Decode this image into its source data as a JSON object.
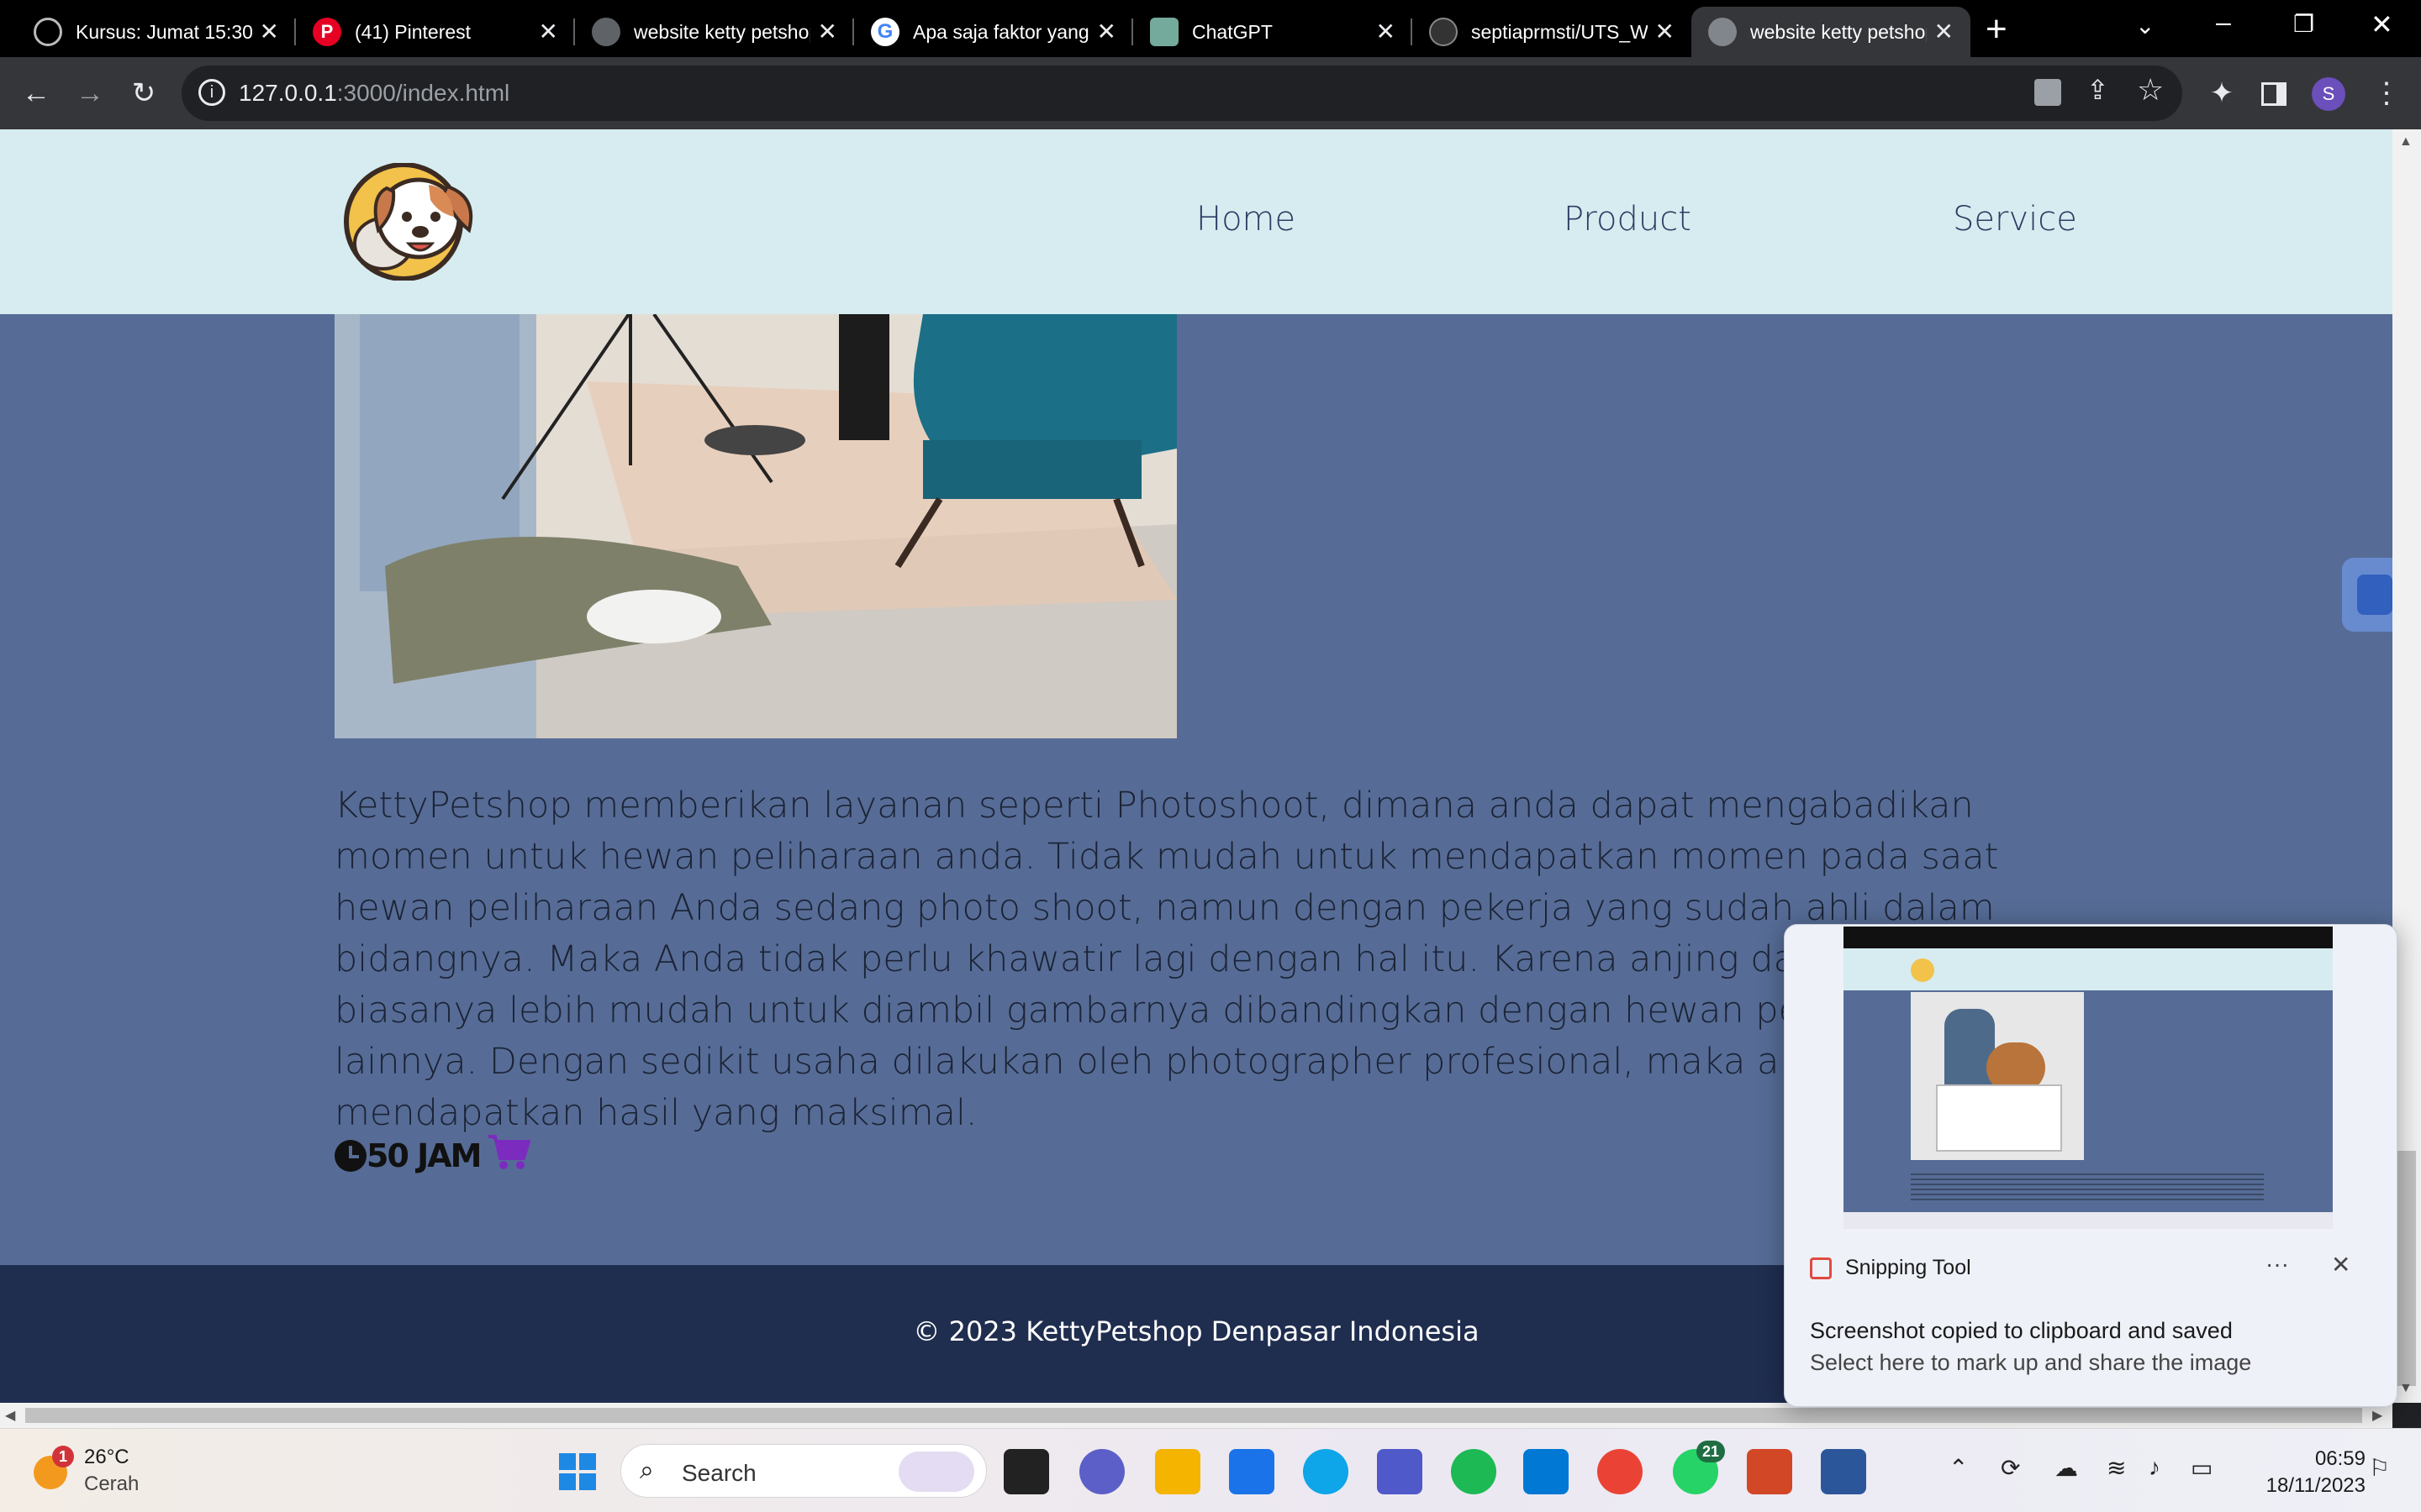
{
  "browser": {
    "tabs": [
      {
        "title": "Kursus: Jumat 15:30",
        "icon": "moodle-icon"
      },
      {
        "title": "(41) Pinterest",
        "icon": "pinterest-icon"
      },
      {
        "title": "website ketty petshop",
        "icon": "globe-icon"
      },
      {
        "title": "Apa saja faktor yang",
        "icon": "google-icon"
      },
      {
        "title": "ChatGPT",
        "icon": "chatgpt-icon"
      },
      {
        "title": "septiaprmsti/UTS_WEB",
        "icon": "github-icon"
      },
      {
        "title": "website ketty petshop",
        "icon": "globe-icon",
        "active": true
      }
    ],
    "url_host": "127.0.0.1",
    "url_path": ":3000/index.html",
    "profile_initial": "S"
  },
  "page": {
    "nav": {
      "home": "Home",
      "product": "Product",
      "service": "Service"
    },
    "description": "KettyPetshop memberikan layanan seperti Photoshoot, dimana anda dapat mengabadikan momen untuk hewan peliharaan anda. Tidak mudah untuk mendapatkan momen pada saat hewan peliharaan Anda sedang photo shoot, namun dengan pekerja yang sudah ahli dalam bidangnya. Maka Anda tidak perlu khawatir lagi dengan hal itu. Karena anjing dan kucing biasanya lebih mudah untuk diambil gambarnya dibandingkan dengan hewan peliharaan yang lainnya. Dengan sedikit usaha dilakukan oleh photographer profesional, maka akan mendapatkan hasil yang maksimal.",
    "hours": "50 JAM",
    "footer": "© 2023 KettyPetshop Denpasar Indonesia",
    "colors": {
      "navbar": "#d6ecf0",
      "content": "#566c96",
      "footer": "#1f2d4f",
      "cart": "#7b2cbf"
    }
  },
  "toast": {
    "app": "Snipping Tool",
    "message": "Screenshot copied to clipboard and saved",
    "sub": "Select here to mark up and share the image",
    "menu": "···"
  },
  "taskbar": {
    "weather_temp": "26°C",
    "weather_desc": "Cerah",
    "weather_badge": "1",
    "search_placeholder": "Search",
    "whatsapp_badge": "21",
    "time": "06:59",
    "date": "18/11/2023"
  }
}
